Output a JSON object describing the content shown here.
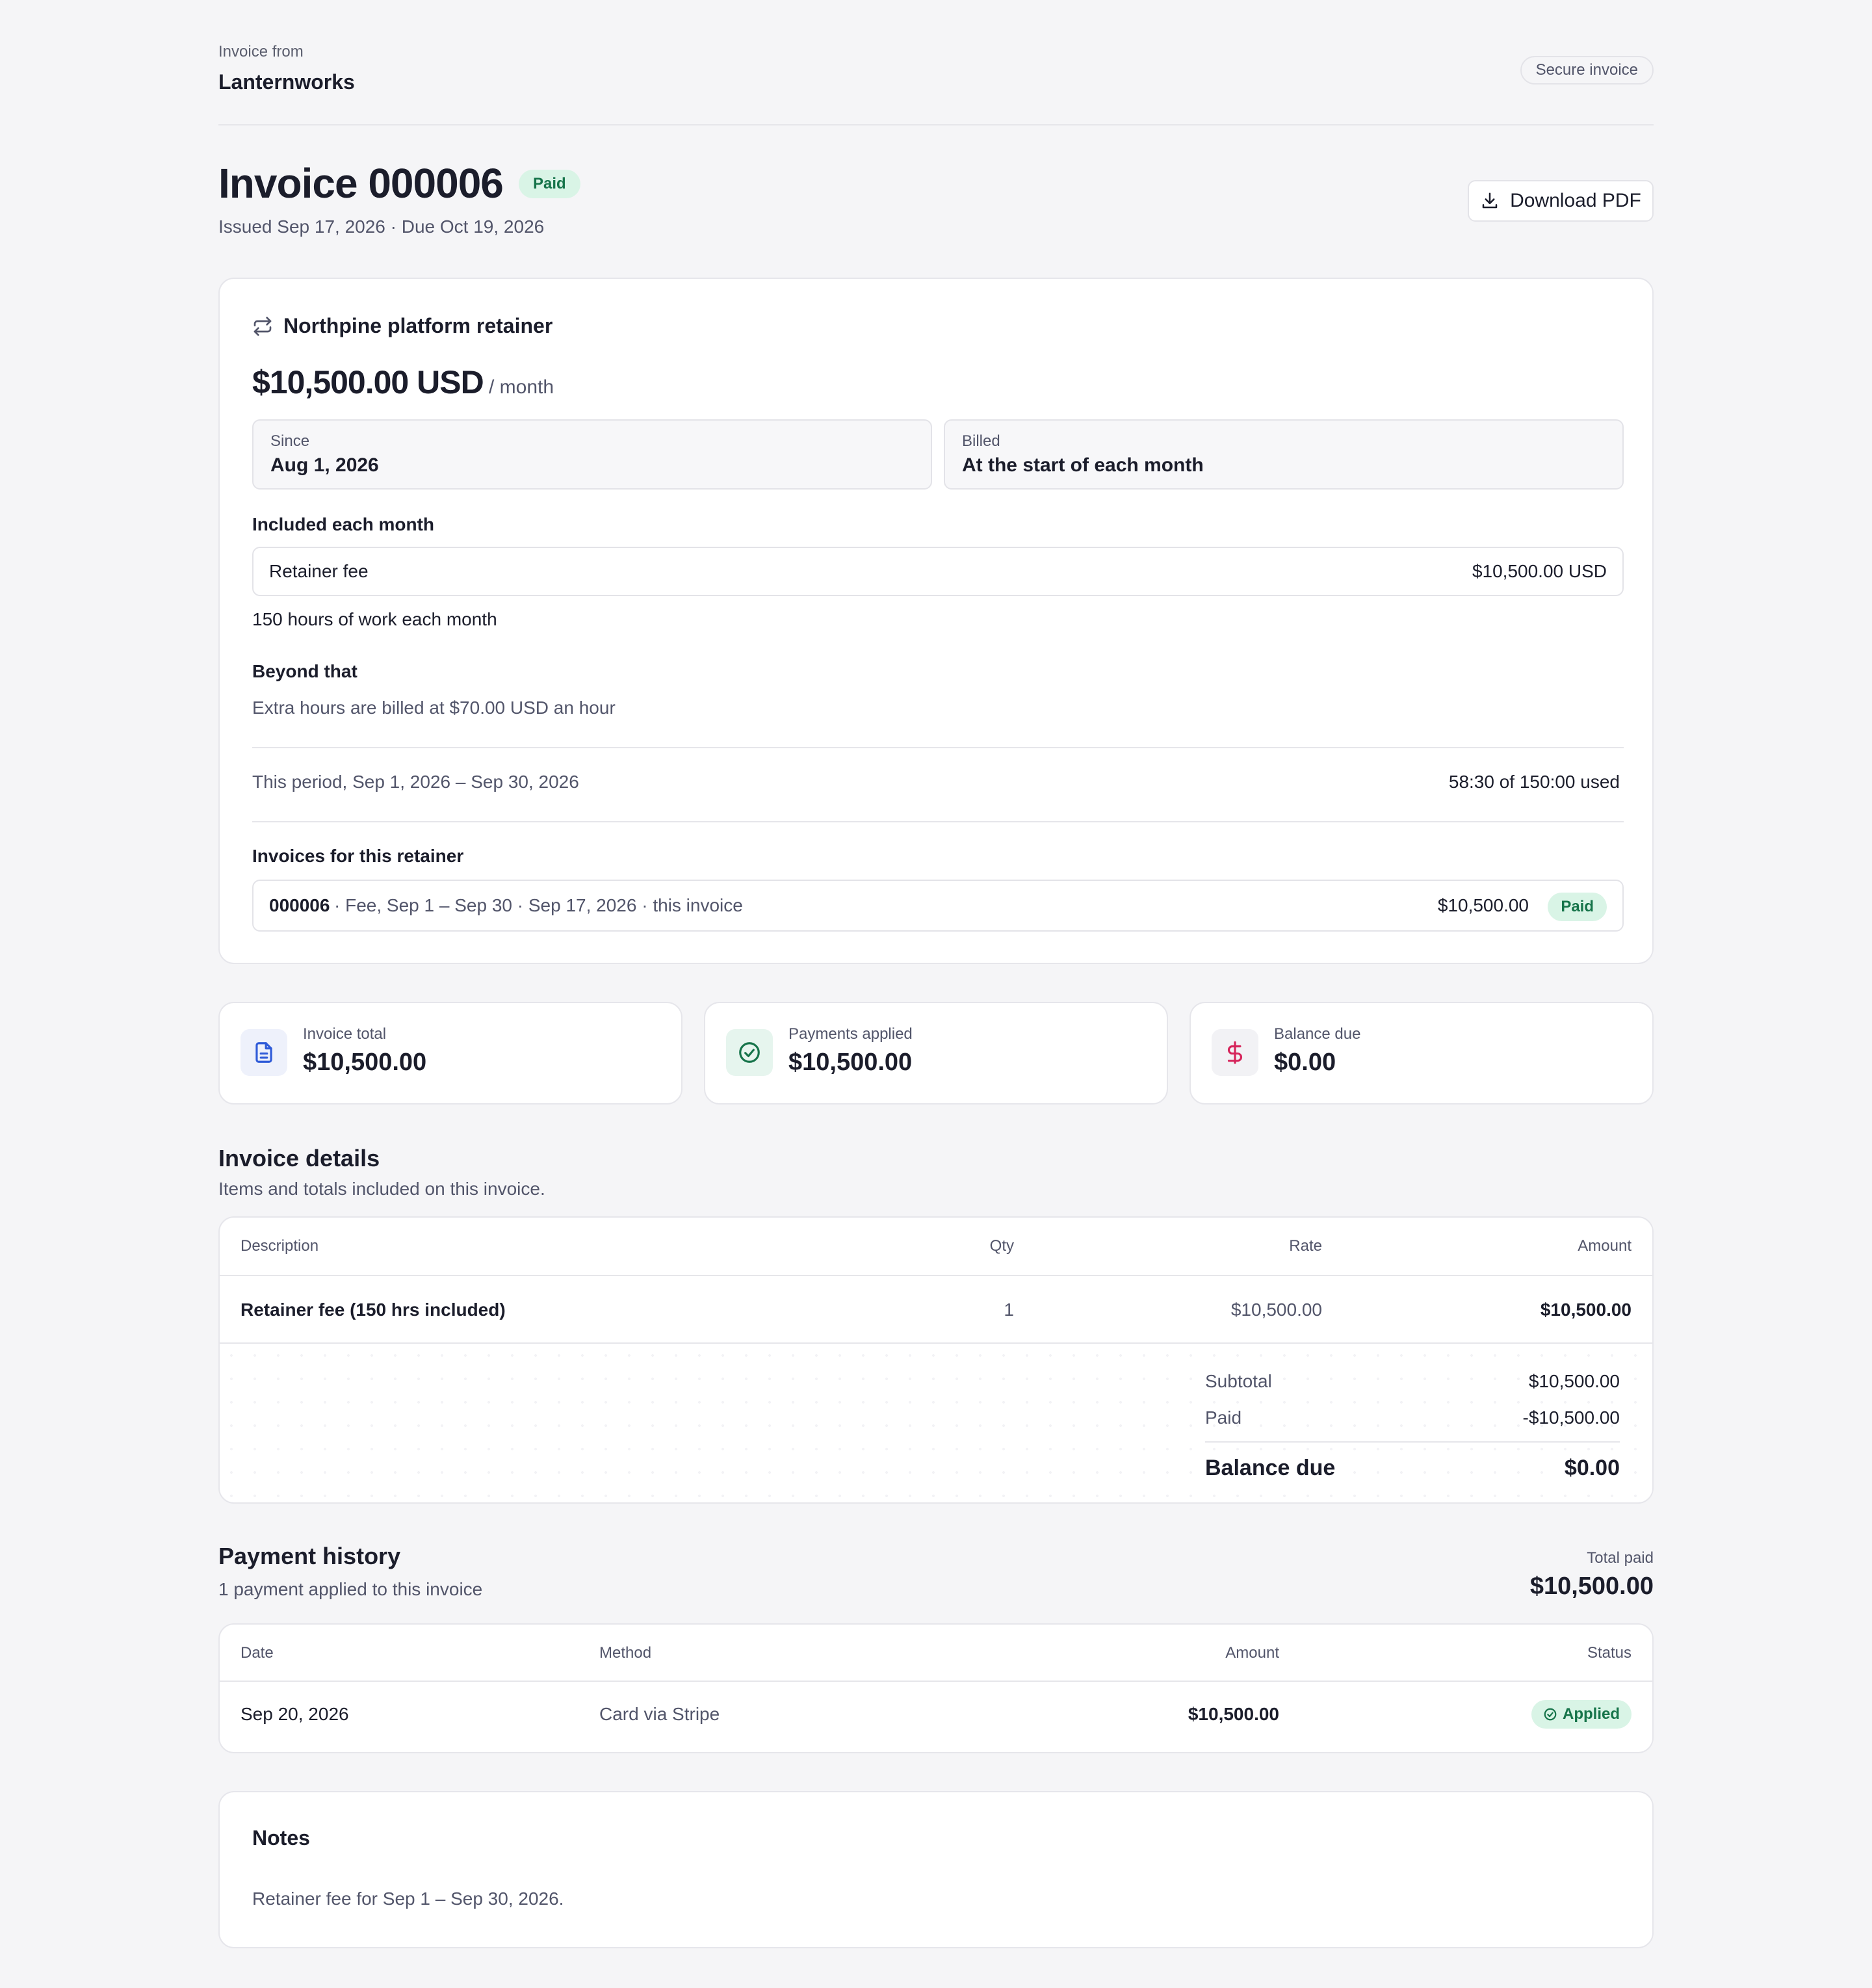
{
  "header": {
    "from_label": "Invoice from",
    "from_name": "Lanternworks",
    "secure_label": "Secure invoice"
  },
  "invoice": {
    "title": "Invoice 000006",
    "status": "Paid",
    "issued": "Issued Sep 17, 2026 · Due Oct 19, 2026",
    "download_label": "Download PDF"
  },
  "retainer": {
    "name": "Northpine platform retainer",
    "price": "$10,500.00 USD",
    "per": "/ month",
    "since_label": "Since",
    "since_value": "Aug 1, 2026",
    "billed_label": "Billed",
    "billed_value": "At the start of each month",
    "included_label": "Included each month",
    "fee_label": "Retainer fee",
    "fee_value": "$10,500.00 USD",
    "hours_note": "150 hours of work each month",
    "beyond_label": "Beyond that",
    "beyond_note": "Extra hours are billed at $70.00 USD an hour",
    "period_label": "This period, Sep 1, 2026 – Sep 30, 2026",
    "period_usage": "58:30 of 150:00 used",
    "invoices_label": "Invoices for this retainer",
    "invoice_row": {
      "number": "000006",
      "detail": "· Fee, Sep 1 – Sep 30 · Sep 17, 2026 · this invoice",
      "amount": "$10,500.00",
      "status": "Paid"
    }
  },
  "stats": [
    {
      "label": "Invoice total",
      "value": "$10,500.00",
      "icon": "document-icon",
      "color": "#2f5bd8"
    },
    {
      "label": "Payments applied",
      "value": "$10,500.00",
      "icon": "check-circle-icon",
      "color": "#16744a"
    },
    {
      "label": "Balance due",
      "value": "$0.00",
      "icon": "dollar-icon",
      "color": "#d6245a"
    }
  ],
  "details": {
    "title": "Invoice details",
    "subtitle": "Items and totals included on this invoice.",
    "columns": [
      "Description",
      "Qty",
      "Rate",
      "Amount"
    ],
    "rows": [
      {
        "description": "Retainer fee (150 hrs included)",
        "qty": "1",
        "rate": "$10,500.00",
        "amount": "$10,500.00"
      }
    ],
    "subtotal_label": "Subtotal",
    "subtotal_value": "$10,500.00",
    "paid_label": "Paid",
    "paid_value": "-$10,500.00",
    "balance_label": "Balance due",
    "balance_value": "$0.00"
  },
  "history": {
    "title": "Payment history",
    "subtitle": "1 payment applied to this invoice",
    "total_label": "Total paid",
    "total_value": "$10,500.00",
    "columns": [
      "Date",
      "Method",
      "Amount",
      "Status"
    ],
    "rows": [
      {
        "date": "Sep 20, 2026",
        "method": "Card via Stripe",
        "amount": "$10,500.00",
        "status": "Applied"
      }
    ]
  },
  "notes": {
    "title": "Notes",
    "text": "Retainer fee for Sep 1 – Sep 30, 2026."
  },
  "colors": {
    "background": "#f5f5f7",
    "paid_bg": "#d9f4e6",
    "paid_text": "#16744a"
  }
}
